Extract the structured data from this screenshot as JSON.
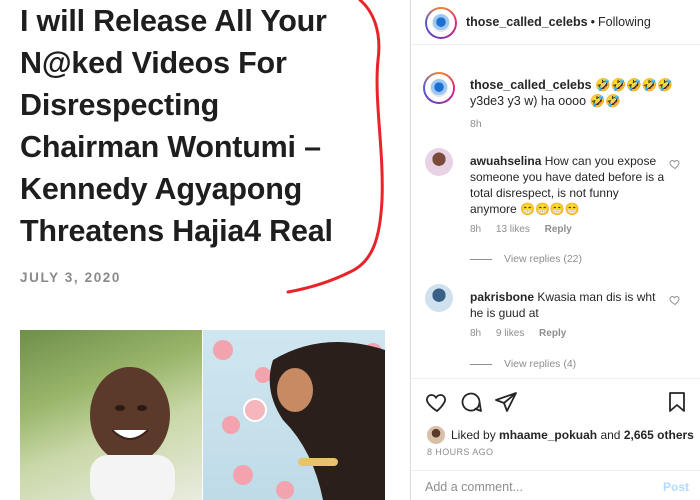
{
  "article": {
    "headline_lines": [
      "I will Release All Your",
      "N@ked Videos For",
      "Disrespecting",
      "Chairman Wontumi –",
      "Kennedy Agyapong",
      "Threatens Hajia4 Real"
    ],
    "date": "JULY 3, 2020"
  },
  "post": {
    "username": "those_called_celebs",
    "separator": "•",
    "follow_status": "Following",
    "caption": {
      "username": "those_called_celebs",
      "text": "🤣🤣🤣🤣🤣 y3de3 y3 w) ha oooo 🤣🤣",
      "age": "8h"
    },
    "comments": [
      {
        "username": "awuahselina",
        "text": "How can you expose someone you have dated before is a total disrespect, is not funny anymore 😁😁😁😁",
        "age": "8h",
        "likes": "13 likes",
        "reply_label": "Reply",
        "view_replies": "View replies (22)"
      },
      {
        "username": "pakrisbone",
        "text": "Kwasia man dis is wht he is guud at",
        "age": "8h",
        "likes": "9 likes",
        "reply_label": "Reply",
        "view_replies": "View replies (4)"
      }
    ],
    "liked_by_prefix": "Liked by",
    "liked_by_user": "mhaame_pokuah",
    "liked_by_and": "and",
    "liked_by_others": "2,665 others",
    "time_ago": "8 HOURS AGO",
    "add_comment_placeholder": "Add a comment...",
    "post_button": "Post"
  },
  "colors": {
    "red_mark": "#e8242a",
    "text_primary": "#262626",
    "text_muted": "#8e8e8e",
    "post_button_disabled": "#b3dbff"
  },
  "icons": [
    "heart-icon",
    "comment-icon",
    "share-icon",
    "bookmark-icon"
  ]
}
